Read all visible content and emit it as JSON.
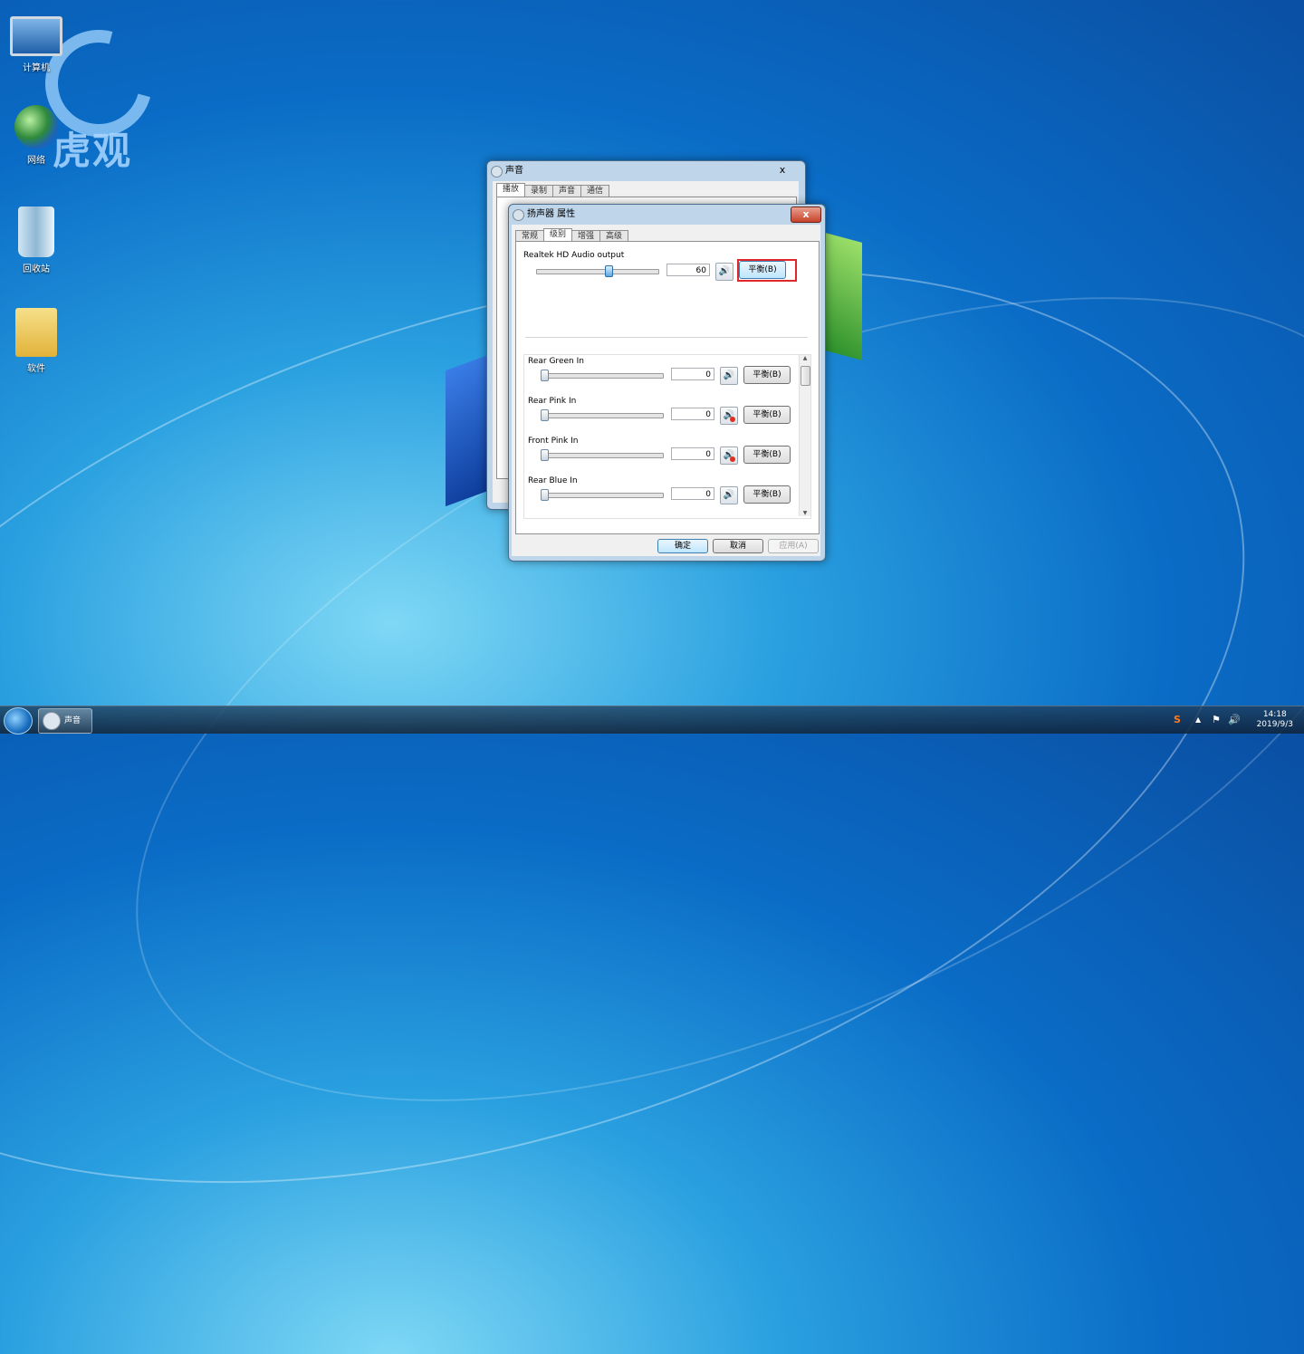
{
  "watermark": {
    "text": "虎观"
  },
  "desktop_icons": [
    {
      "label": "计算机",
      "icon": "computer-icon"
    },
    {
      "label": "网络",
      "icon": "network-icon"
    },
    {
      "label": "回收站",
      "icon": "recycle-bin-icon"
    },
    {
      "label": "软件",
      "icon": "folder-icon"
    }
  ],
  "sound_window": {
    "title": "声音",
    "close_label": "x",
    "tabs": [
      "播放",
      "录制",
      "声音",
      "通信"
    ]
  },
  "speaker_window": {
    "title": "扬声器 属性",
    "close_label": "x",
    "tabs": [
      "常规",
      "级别",
      "增强",
      "高级"
    ],
    "selected_tab": "级别",
    "main": {
      "label": "Realtek HD Audio output",
      "value": "60",
      "level": 0.6,
      "balance_label": "平衡(B)"
    },
    "channels": [
      {
        "label": "Rear Green In",
        "value": "0",
        "muted": false,
        "balance_label": "平衡(B)"
      },
      {
        "label": "Rear Pink In",
        "value": "0",
        "muted": true,
        "balance_label": "平衡(B)"
      },
      {
        "label": "Front Pink In",
        "value": "0",
        "muted": true,
        "balance_label": "平衡(B)"
      },
      {
        "label": "Rear Blue In",
        "value": "0",
        "muted": false,
        "balance_label": "平衡(B)"
      }
    ],
    "buttons": {
      "ok": "确定",
      "cancel": "取消",
      "apply": "应用(A)"
    }
  },
  "taskbar": {
    "item_label": "声音",
    "time": "14:18",
    "date": "2019/9/3",
    "tray_icons": [
      "sogou-icon",
      "show-hidden-icon",
      "network-icon",
      "volume-icon"
    ]
  },
  "colors": {
    "highlight": "#e0282c",
    "accent": "#1f63b8"
  }
}
